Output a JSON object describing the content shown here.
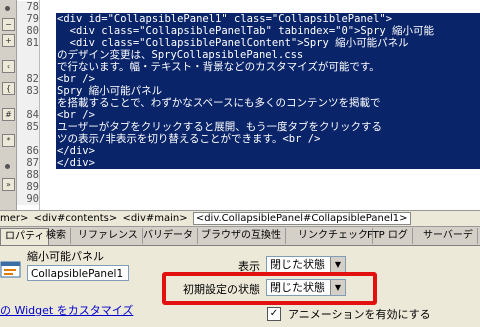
{
  "editor": {
    "lines": [
      {
        "num": "78",
        "text": "",
        "selected": false
      },
      {
        "num": "79",
        "text": "<div id=\"CollapsiblePanel1\" class=\"CollapsiblePanel\">",
        "selected": true
      },
      {
        "num": "80",
        "text": "  <div class=\"CollapsiblePanelTab\" tabindex=\"0\">Spry 縮小可能",
        "selected": true
      },
      {
        "num": "81",
        "text": "  <div class=\"CollapsiblePanelContent\">Spry 縮小可能パネル",
        "selected": true
      },
      {
        "num": "",
        "text": "のデザイン変更は、SpryCollapsiblePanel.css",
        "selected": true
      },
      {
        "num": "",
        "text": "で行ないます。幅・テキスト・背景などのカスタマイズが可能です。",
        "selected": true
      },
      {
        "num": "82",
        "text": "<br />",
        "selected": true
      },
      {
        "num": "83",
        "text": "Spry 縮小可能パネル",
        "selected": true
      },
      {
        "num": "",
        "text": "を搭載することで、わずかなスペースにも多くのコンテンツを掲載で",
        "selected": true
      },
      {
        "num": "84",
        "text": "<br />",
        "selected": true
      },
      {
        "num": "85",
        "text": "ユーザーがタブをクリックすると展開、もう一度タブをクリックする",
        "selected": true
      },
      {
        "num": "",
        "text": "ツの表示/非表示を切り替えることができます。<br />",
        "selected": true
      },
      {
        "num": "86",
        "text": "</div>",
        "selected": true
      },
      {
        "num": "87",
        "text": "</div>",
        "selected": true
      },
      {
        "num": "88",
        "text": "",
        "selected": false
      },
      {
        "num": "89",
        "text": "",
        "selected": false
      },
      {
        "num": "90",
        "text": "",
        "selected": false
      }
    ],
    "selection_color": "#0a246a"
  },
  "tagbar": {
    "items": [
      "mer>",
      "<div#contents>",
      "<div#main>"
    ],
    "current": "<div.CollapsiblePanel#CollapsiblePanel1>"
  },
  "tabs": [
    "ロパティ",
    "検索",
    "リファレンス",
    "バリデータ",
    "ブラウザの互換性",
    "リンクチェック",
    "FTP ログ",
    "サーバーデ"
  ],
  "properties": {
    "widget_type_label": "縮小可能パネル",
    "widget_name": "CollapsiblePanel1",
    "customize_link": "の Widget をカスタマイズ",
    "display_label": "表示",
    "display_value": "閉じた状態",
    "default_state_label": "初期設定の状態",
    "default_state_value": "閉じた状態",
    "animation_label": "アニメーションを有効にする",
    "animation_checked": true,
    "highlight_color": "#e31010"
  }
}
